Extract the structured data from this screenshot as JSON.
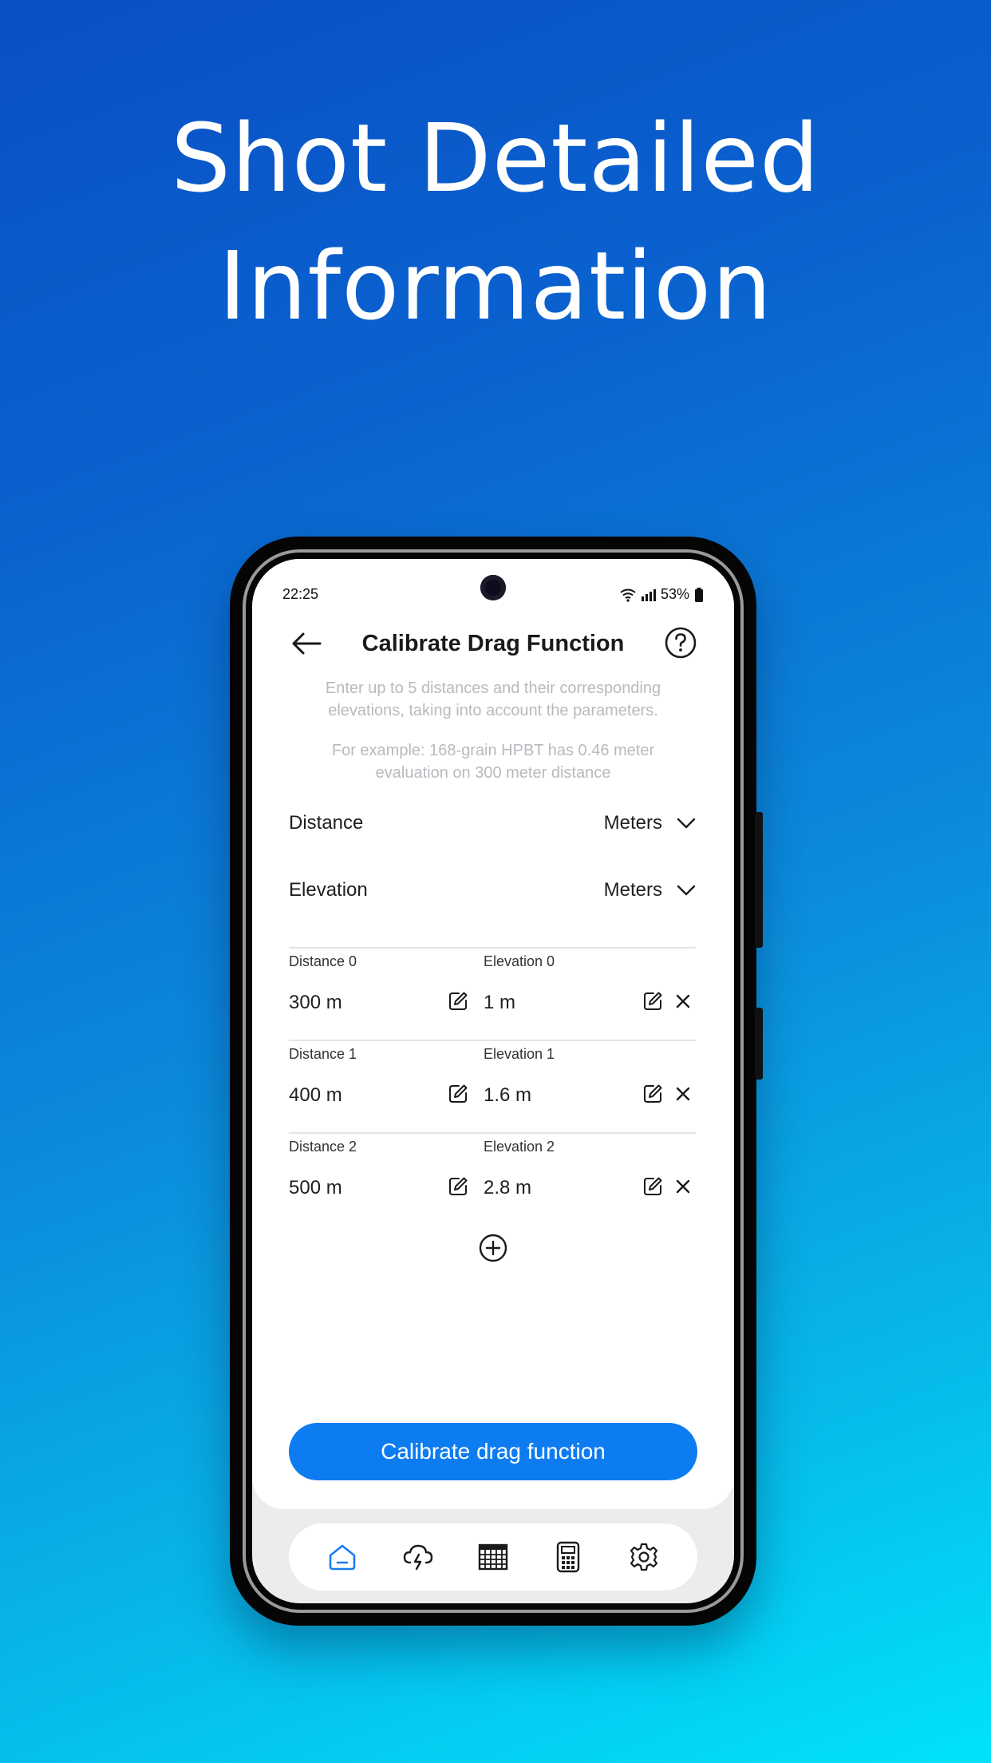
{
  "headline": {
    "line1": "Shot Detailed",
    "line2": "Information"
  },
  "status_bar": {
    "time": "22:25",
    "battery": "53%"
  },
  "header": {
    "title": "Calibrate Drag Function"
  },
  "description": {
    "line1a": "Enter up to 5 distances and their corresponding",
    "line1b": "elevations, taking into account the parameters.",
    "line2a": "For example: 168-grain HPBT has 0.46 meter",
    "line2b": "evaluation on 300 meter distance"
  },
  "units": {
    "distance": {
      "label": "Distance",
      "value": "Meters"
    },
    "elevation": {
      "label": "Elevation",
      "value": "Meters"
    }
  },
  "entries": [
    {
      "distance_label": "Distance 0",
      "distance_value": "300 m",
      "elevation_label": "Elevation 0",
      "elevation_value": "1 m"
    },
    {
      "distance_label": "Distance 1",
      "distance_value": "400 m",
      "elevation_label": "Elevation 1",
      "elevation_value": "1.6 m"
    },
    {
      "distance_label": "Distance 2",
      "distance_value": "500 m",
      "elevation_label": "Elevation 2",
      "elevation_value": "2.8 m"
    }
  ],
  "cta": {
    "label": "Calibrate drag function"
  },
  "tabs": [
    {
      "icon": "home-icon",
      "active": true
    },
    {
      "icon": "weather-icon",
      "active": false
    },
    {
      "icon": "table-icon",
      "active": false
    },
    {
      "icon": "calculator-icon",
      "active": false
    },
    {
      "icon": "settings-icon",
      "active": false
    }
  ],
  "colors": {
    "accent": "#0d7cf1",
    "text": "#1f1f1f",
    "muted": "#b9b9bf"
  }
}
